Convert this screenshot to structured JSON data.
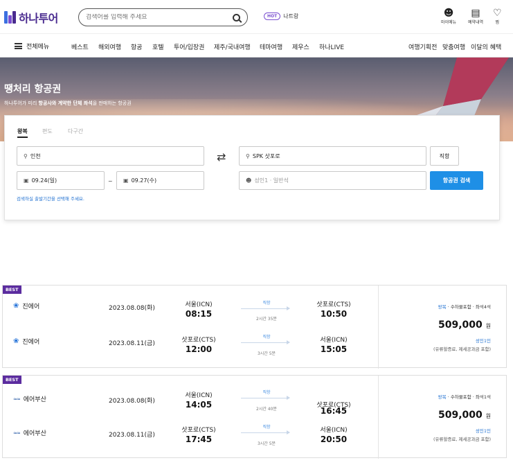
{
  "header": {
    "logo": "하나투어",
    "search_placeholder": "검색어를 입력해 주세요",
    "hot_badge": "HOT",
    "hot_text": "나트랑",
    "mypage": "마이메뉴",
    "reservation": "예약내역",
    "wish": "찜"
  },
  "nav": {
    "all_menu": "전체메뉴",
    "items": [
      "베스트",
      "해외여행",
      "항공",
      "호텔",
      "투어/입장권",
      "제주/국내여행",
      "테마여행",
      "제우스",
      "하나LIVE"
    ],
    "right": [
      "여행기획전",
      "맞춤여행",
      "이달의 혜택"
    ]
  },
  "hero": {
    "title": "땡처리 항공권",
    "sub_pre": "하나투어가 미리 ",
    "sub_bold": "항공사와 계약한 단체 좌석",
    "sub_post": "을 판매하는 항공권"
  },
  "search": {
    "tabs": [
      "왕복",
      "편도",
      "다구간"
    ],
    "from": "인천",
    "to": "SPK 삿포로",
    "depart_date": "09.24(일)",
    "return_date": "09.27(수)",
    "tilde": "~",
    "passenger": "성인1 · 일반석",
    "direct_btn": "직항",
    "search_btn": "항공권 검색",
    "hint": "검색하실 출발기간을 선택해 주세요."
  },
  "results": [
    {
      "badge": "BEST",
      "legs": [
        {
          "airline": "진에어",
          "date": "2023.08.08(화)",
          "from_city": "서울(ICN)",
          "from_time": "08:15",
          "direct": "직항",
          "duration": "2시간 35분",
          "to_city": "삿포로(CTS)",
          "to_time": "10:50"
        },
        {
          "airline": "진에어",
          "date": "2023.08.11(금)",
          "from_city": "삿포로(CTS)",
          "from_time": "12:00",
          "direct": "직항",
          "duration": "3시간 5분",
          "to_city": "서울(ICN)",
          "to_time": "15:05"
        }
      ],
      "trip": "왕복",
      "baggage": "수하물포함",
      "seats": "좌석4석",
      "price": "509,000",
      "won": "원",
      "pax": "성인1인",
      "fee": "(유류할증료, 제세공과금 포함)"
    },
    {
      "badge": "BEST",
      "legs": [
        {
          "airline": "에어부산",
          "date": "2023.08.08(화)",
          "from_city": "서울(ICN)",
          "from_time": "14:05",
          "direct": "직항",
          "duration": "2시간 40분",
          "to_city": "삿포로(CTS)",
          "to_time": "16:45"
        },
        {
          "airline": "에어부산",
          "date": "2023.08.11(금)",
          "from_city": "삿포로(CTS)",
          "from_time": "17:45",
          "direct": "직항",
          "duration": "3시간 5분",
          "to_city": "서울(ICN)",
          "to_time": "20:50"
        }
      ],
      "trip": "왕복",
      "baggage": "수하물포함",
      "seats": "좌석1석",
      "price": "509,000",
      "won": "원",
      "pax": "성인1인",
      "fee": "(유류할증료, 제세공과금 포함)"
    }
  ]
}
